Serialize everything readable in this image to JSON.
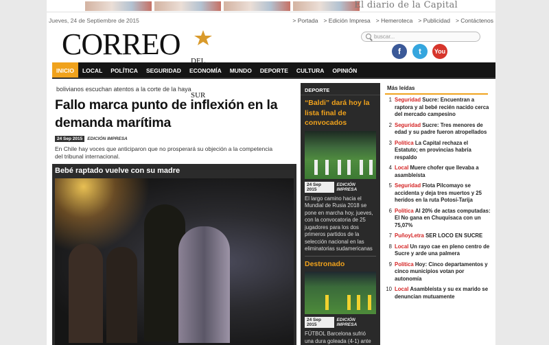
{
  "banner": {
    "tagline": "El diario de la Capital"
  },
  "header": {
    "date": "Jueves, 24 de Septiembre de 2015",
    "links": [
      "> Portada",
      "> Edición Impresa",
      "> Hemeroteca",
      "> Publicidad",
      "> Contáctenos"
    ],
    "logo_main": "CORREO",
    "logo_sub": "DEL SUR",
    "search_placeholder": "buscar...",
    "social": [
      {
        "name": "facebook",
        "glyph": "f",
        "color": "#3b5998"
      },
      {
        "name": "twitter",
        "glyph": "t",
        "color": "#35a6de"
      },
      {
        "name": "youtube",
        "glyph": "You",
        "color": "#d6352b"
      }
    ]
  },
  "nav": {
    "items": [
      "INICIO",
      "LOCAL",
      "POLÍTICA",
      "SEGURIDAD",
      "ECONOMÍA",
      "MUNDO",
      "DEPORTE",
      "CULTURA",
      "OPINIÓN"
    ],
    "active": "INICIO",
    "accent": "#f0a21c"
  },
  "main": {
    "kicker": "bolivianos escuchan atentos a la corte de la haya",
    "headline": "Fallo marca punto de inflexión en la demanda marítima",
    "date": "24 Sep 2015",
    "edition": "EDICIÓN IMPRESA",
    "summary": "En Chile hay voces que anticiparon que no prosperará su objeción a la competencia del tribunal internacional.",
    "story_title": "Bebé raptado vuelve con su madre"
  },
  "sports": {
    "section": "DEPORTE",
    "story1": {
      "title": "“Baldi” dará hoy la lista final de convocados",
      "date": "24 Sep 2015",
      "edition": "EDICIÓN IMPRESA",
      "text": "El largo camino hacia el Mundial de Rusia 2018 se pone en marcha hoy, jueves, con la convocatoria de 25 jugadores para los dos primeros partidos de la selección nacional en las eliminatorias sudamericanas"
    },
    "story2": {
      "title": "Destronado",
      "date": "24 Sep 2015",
      "edition": "EDICIÓN IMPRESA",
      "text": "FÚTBOL Barcelona sufrió una dura goleada (4-1) ante"
    }
  },
  "most_read": {
    "title": "Más leídas",
    "items": [
      {
        "n": "1",
        "cat": "Seguridad",
        "text": "Sucre: Encuentran a raptora y al bebé recién nacido cerca del mercado campesino"
      },
      {
        "n": "2",
        "cat": "Seguridad",
        "text": "Sucre: Tres menores de edad y su padre fueron atropellados"
      },
      {
        "n": "3",
        "cat": "Política",
        "text": "La Capital rechaza el Estatuto; en provincias habría respaldo"
      },
      {
        "n": "4",
        "cat": "Local",
        "text": "Muere chofer que llevaba a asambleísta"
      },
      {
        "n": "5",
        "cat": "Seguridad",
        "text": "Flota Pilcomayo se accidenta y deja tres muertos y 25 heridos en la ruta Potosí-Tarija"
      },
      {
        "n": "6",
        "cat": "Política",
        "text": "Al 20% de actas computadas: El No gana en Chuquisaca con un 75,07%"
      },
      {
        "n": "7",
        "cat": "PuñoyLetra",
        "text": "SER LOCO EN SUCRE"
      },
      {
        "n": "8",
        "cat": "Local",
        "text": "Un rayo cae en pleno centro de Sucre y arde una palmera"
      },
      {
        "n": "9",
        "cat": "Política",
        "text": "Hoy: Cinco departamentos y cinco municipios votan por autonomía"
      },
      {
        "n": "10",
        "cat": "Local",
        "text": "Asambleísta y su ex marido se denuncian mutuamente"
      }
    ]
  }
}
